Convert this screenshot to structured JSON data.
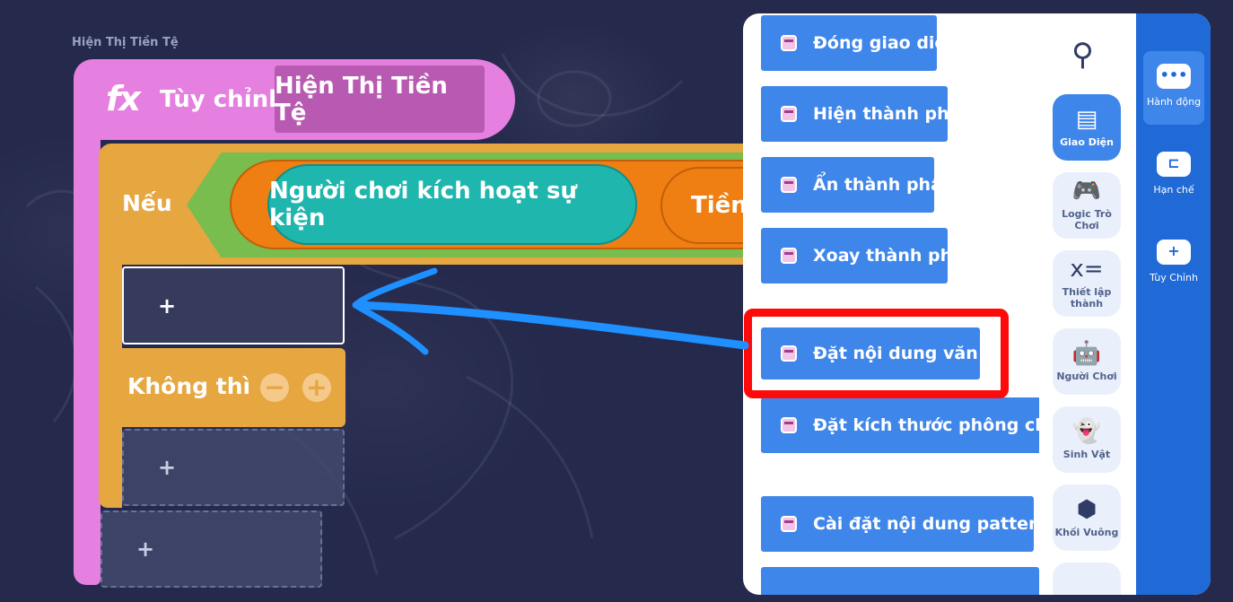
{
  "function": {
    "caption": "Hiện Thị Tiền Tệ",
    "icon": "fx",
    "type_label": "Tùy chỉnh",
    "name": "Hiện Thị Tiền Tệ"
  },
  "if_block": {
    "if_label": "Nếu",
    "condition_event": "Người chơi kích hoạt sự kiện",
    "condition_partial": "Tiền",
    "else_label": "Không thì",
    "minus": "−",
    "plus": "+"
  },
  "slots": {
    "then_slot": "+",
    "else_slot": "+",
    "after_slot": "+"
  },
  "block_list": [
    "Đóng giao diện",
    "Hiện thành phần",
    "Ẩn thành phần",
    "Xoay thành phần",
    "Đặt nội dung văn bản",
    "Đặt kích thước phông chữ văn b",
    "Cài đặt nội dung pattern\\nút"
  ],
  "categories": [
    {
      "label": "Giao Diện",
      "icon": "window-icon",
      "glyph": "▤"
    },
    {
      "label": "Logic Trò Chơi",
      "icon": "gamepad-icon",
      "glyph": "🎮"
    },
    {
      "label": "Thiết lập thành",
      "icon": "formula-icon",
      "glyph": "x="
    },
    {
      "label": "Người Chơi",
      "icon": "robot-icon",
      "glyph": "🤖"
    },
    {
      "label": "Sinh Vật",
      "icon": "ghost-icon",
      "glyph": "👻"
    },
    {
      "label": "Khối Vuông",
      "icon": "cube-icon",
      "glyph": "⬢"
    }
  ],
  "side_tabs": [
    {
      "label": "Hành động",
      "icon": "chat-dots-icon",
      "glyph": "•••"
    },
    {
      "label": "Hạn chế",
      "icon": "bracket-icon",
      "glyph": "⊏"
    },
    {
      "label": "Tùy Chỉnh",
      "icon": "cloud-plus-icon",
      "glyph": "+"
    }
  ],
  "colors": {
    "background": "#252a4d",
    "function": "#e57fe0",
    "if_block": "#e6a640",
    "block_blue": "#3f86ea",
    "sidebar": "#1f6ad7",
    "highlight": "#ff0a0a",
    "arrow": "#1e90ff"
  }
}
